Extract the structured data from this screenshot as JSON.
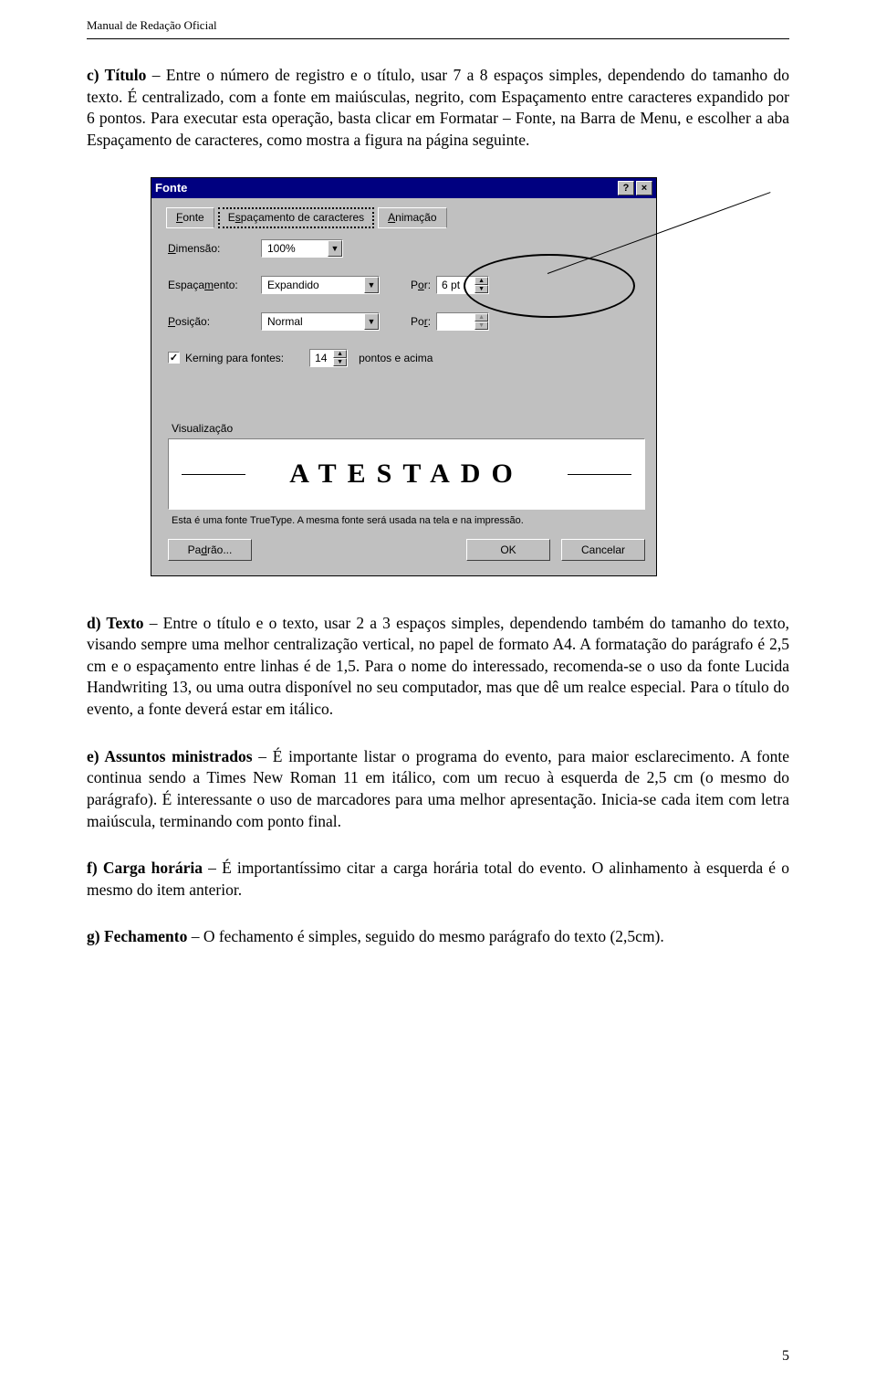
{
  "header": "Manual de Redação Oficial",
  "para_c": {
    "lead_bold": "c) Título",
    "text": " – Entre o número de registro e o título, usar 7 a 8 espaços simples, dependendo do tamanho do texto. É centralizado, com a fonte em maiúsculas, negrito, com Espaçamento entre caracteres expandido por 6 pontos. Para executar esta operação, basta clicar em Formatar – Fonte, na Barra de Menu, e escolher a aba Espaçamento de caracteres, como mostra a figura na página seguinte."
  },
  "dialog": {
    "title": "Fonte",
    "help_btn": "?",
    "close_btn": "×",
    "tabs": {
      "font": "Fonte",
      "spacing": "Espaçamento de caracteres",
      "anim": "Animação",
      "f_ul": "F",
      "s_ul": "s",
      "a_ul": "A"
    },
    "dimensao_label": "Dimensão:",
    "dimensao_ul": "D",
    "dimensao_val": "100%",
    "espac_label": "Espaçamento:",
    "espac_ul": "m",
    "espac_val": "Expandido",
    "por1_label": "Por:",
    "por1_ul": "o",
    "por1_val": "6 pt",
    "posicao_label": "Posição:",
    "posicao_ul": "P",
    "posicao_val": "Normal",
    "por2_label": "Por:",
    "por2_ul": "r",
    "por2_val": "",
    "kerning_label": "Kerning para fontes:",
    "kerning_ul": "K",
    "kerning_val": "14",
    "kerning_after": "pontos e acima",
    "preview_label": "Visualização",
    "preview_text": "ATESTADO",
    "preview_note": "Esta é uma fonte TrueType. A mesma fonte será usada na tela e na impressão.",
    "btn_default": "Padrão...",
    "btn_default_ul": "d",
    "btn_ok": "OK",
    "btn_cancel": "Cancelar"
  },
  "para_d": {
    "lead_bold": "d) Texto",
    "text": " – Entre o título e o texto, usar 2 a 3 espaços simples, dependendo também do tamanho do texto, visando sempre uma melhor centralização vertical, no papel de formato A4. A formatação do  parágrafo é 2,5 cm e o espaçamento entre linhas é de 1,5. Para o nome do interessado, recomenda-se o uso da fonte Lucida Handwriting 13, ou uma outra disponível no seu computador, mas que dê um realce especial. Para o título do evento, a fonte deverá estar em itálico."
  },
  "para_e": {
    "lead_bold": "e) Assuntos ministrados",
    "text": " – É importante listar o programa do evento, para maior esclarecimento. A fonte continua sendo a Times New Roman 11 em itálico, com um recuo à esquerda de 2,5 cm (o mesmo do parágrafo). É interessante o uso de marcadores para uma melhor apresentação. Inicia-se cada item com letra maiúscula, terminando com ponto final."
  },
  "para_f": {
    "lead_bold": "f) Carga horária",
    "text": " – É importantíssimo citar a carga horária total do evento. O alinhamento à esquerda é o mesmo do item anterior."
  },
  "para_g": {
    "lead_bold": "g) Fechamento",
    "text": " – O fechamento é simples, seguido do mesmo parágrafo do texto (2,5cm)."
  },
  "page_number": "5"
}
